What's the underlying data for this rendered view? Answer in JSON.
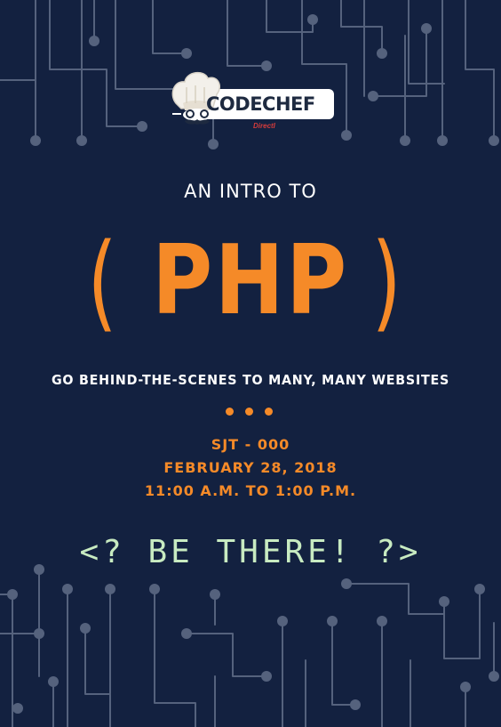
{
  "brand": {
    "name": "CODECHEF",
    "sponsor": "DirectI"
  },
  "headline": {
    "intro": "AN INTRO TO",
    "open_paren": "(",
    "topic": "PHP",
    "close_paren": ")"
  },
  "tagline": "GO BEHIND-THE-SCENES TO MANY, MANY WEBSITES",
  "event": {
    "venue": "SJT - 000",
    "date": "FEBRUARY 28, 2018",
    "time": "11:00 A.M. TO 1:00 P.M."
  },
  "cta": "<? BE THERE! ?>",
  "colors": {
    "background": "#132140",
    "accent_orange": "#f58a28",
    "mint": "#c8ebc1",
    "circuit": "#55627d"
  },
  "icons": {
    "logo_mascot": "chef-hat-icon",
    "divider": "three-dots-icon",
    "decor": "circuit-board-pattern"
  }
}
